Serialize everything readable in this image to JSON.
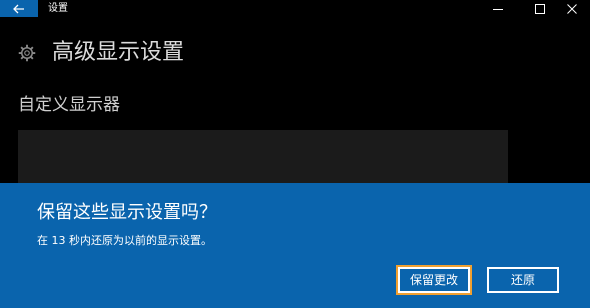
{
  "window": {
    "title": "设置",
    "back_icon": "back-arrow-icon",
    "controls": [
      "minimize-icon",
      "maximize-icon",
      "close-icon"
    ]
  },
  "page": {
    "icon": "gear-icon",
    "title": "高级显示设置",
    "section_title": "自定义显示器"
  },
  "dialog": {
    "title": "保留这些显示设置吗？",
    "message": "在 13 秒内还原为以前的显示设置。",
    "keep_label": "保留更改",
    "revert_label": "还原",
    "accent": "#0a64ad",
    "focus_color": "#f0a030"
  }
}
